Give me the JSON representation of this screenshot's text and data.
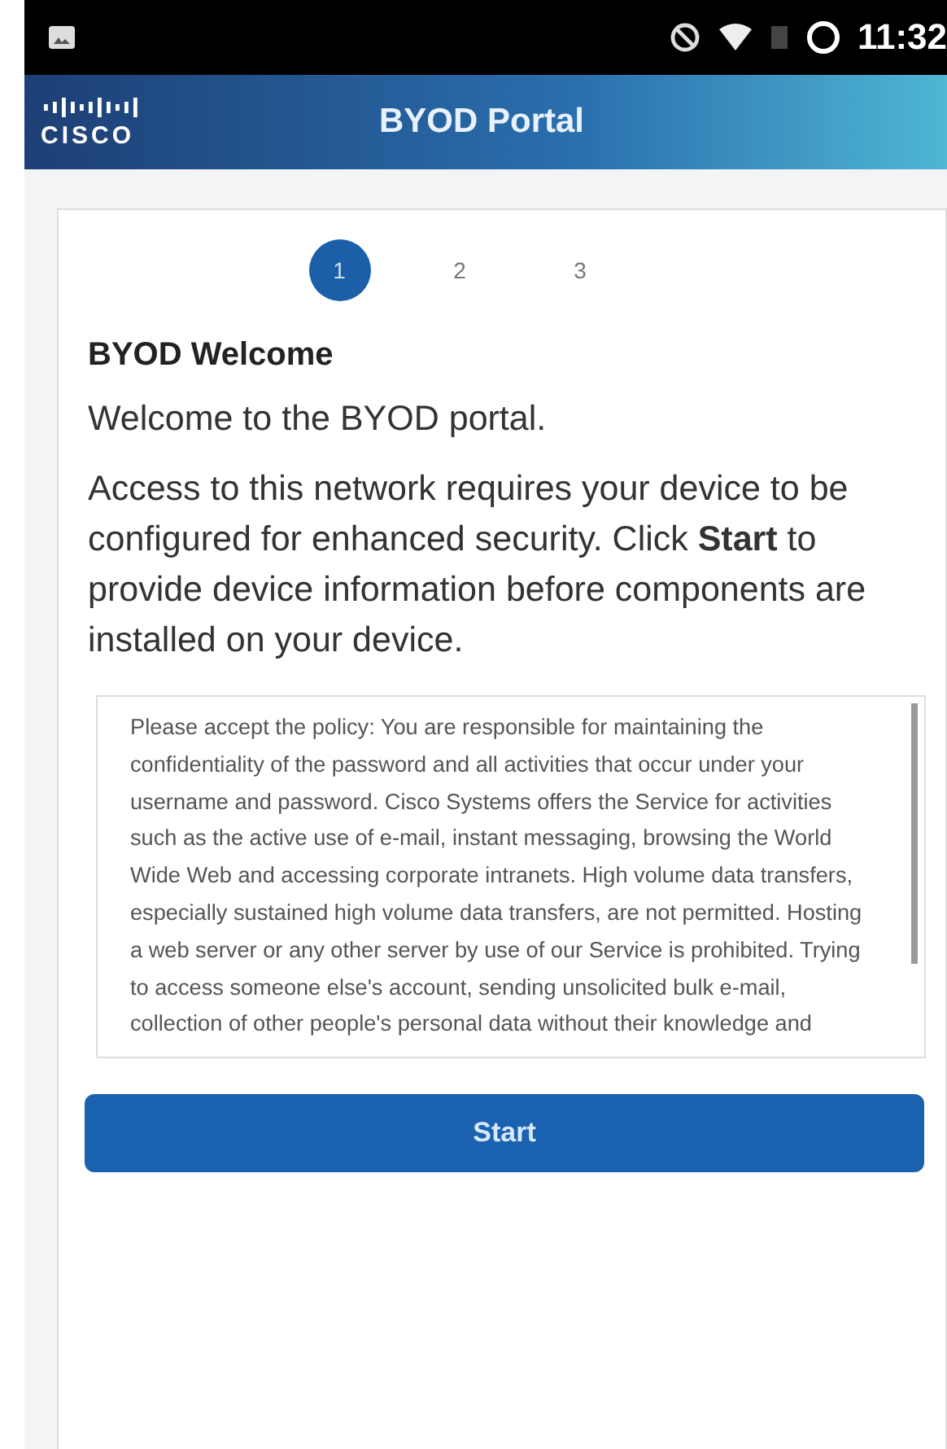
{
  "status_bar": {
    "time": "11:32"
  },
  "header": {
    "logo": "CISCO",
    "title": "BYOD Portal"
  },
  "steps": [
    {
      "label": "1",
      "selected": true
    },
    {
      "label": "2",
      "selected": false
    },
    {
      "label": "3",
      "selected": false
    }
  ],
  "heading": "BYOD Welcome",
  "welcome": "Welcome to the BYOD portal.",
  "intro": "Access to this network requires your device to be configured for enhanced security. Click **Start** to provide device information before components are installed on your device.",
  "policy": "Please accept the policy: You are responsible for maintaining the confidentiality of the password and all activities that occur under your username and password. Cisco Systems offers the Service for activities such as the active use of e-mail, instant messaging, browsing the World Wide Web and accessing corporate intranets. High volume data transfers, especially sustained high volume data transfers, are not permitted. Hosting a web server or any other server by use of our Service is prohibited. Trying to access someone else's account, sending unsolicited bulk e-mail, collection of other people's personal data without their knowledge and",
  "button": "Start"
}
